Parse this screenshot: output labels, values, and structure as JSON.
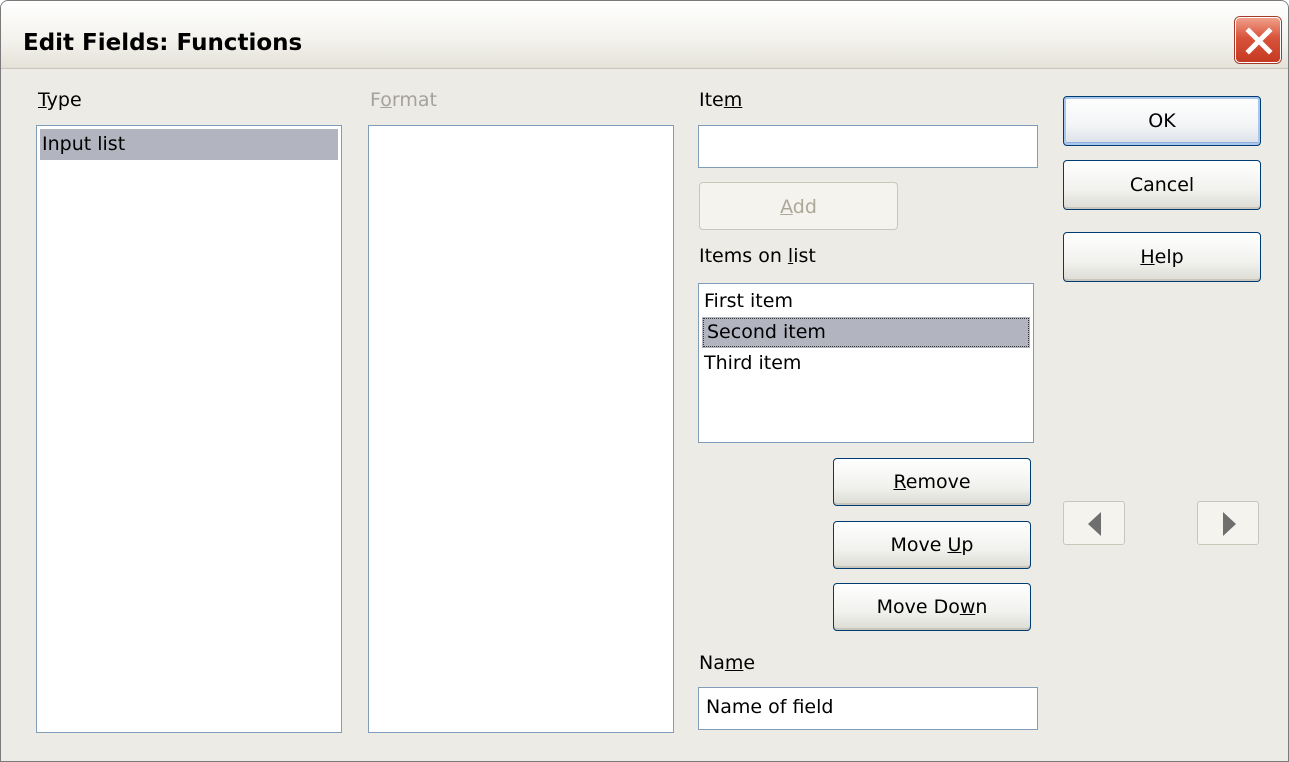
{
  "dialog": {
    "title": "Edit Fields: Functions",
    "close_icon": "close-icon",
    "accent_close": "#d8533a",
    "selection_color": "#b2b4bf"
  },
  "type": {
    "label_access": "T",
    "label_rest": "ype",
    "items": [
      "Input list"
    ],
    "selected": "Input list"
  },
  "format": {
    "label_pre": "F",
    "label_access": "o",
    "label_rest": "rmat"
  },
  "item": {
    "label_pre": "Ite",
    "label_access": "m",
    "value": ""
  },
  "add_button": {
    "access": "A",
    "rest": "dd"
  },
  "items_on_list": {
    "label_pre": "Items on ",
    "label_access": "l",
    "label_rest": "ist",
    "items": [
      "First item",
      "Second item",
      "Third item"
    ],
    "selected": "Second item"
  },
  "buttons": {
    "remove_access": "R",
    "remove_rest": "emove",
    "moveup_pre": "Move ",
    "moveup_access": "U",
    "moveup_rest": "p",
    "movedown_pre": "Move Do",
    "movedown_access": "w",
    "movedown_rest": "n",
    "ok": "OK",
    "cancel": "Cancel",
    "help_access": "H",
    "help_rest": "elp"
  },
  "name": {
    "label_pre": "Na",
    "label_access": "m",
    "label_rest": "e",
    "value": "Name of field"
  },
  "nav": {
    "prev_icon": "arrow-left-icon",
    "next_icon": "arrow-right-icon"
  }
}
